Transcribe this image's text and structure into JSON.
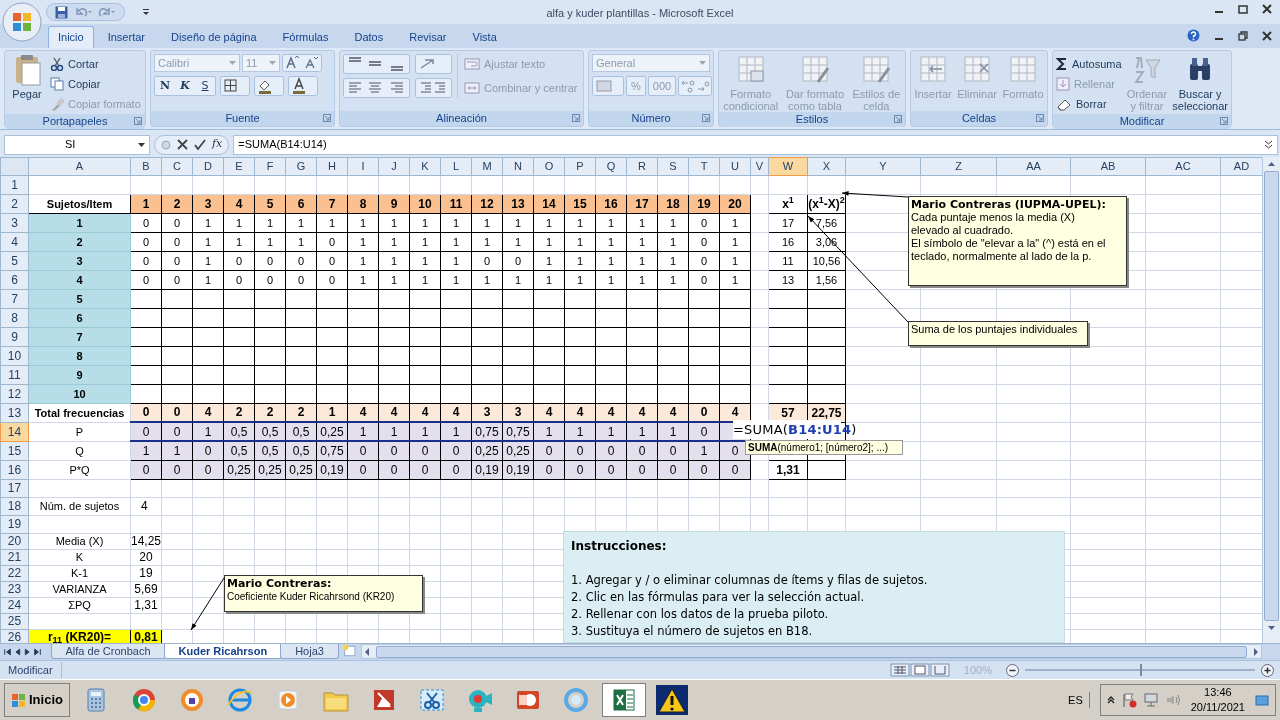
{
  "window": {
    "title": "alfa y kuder plantillas - Microsoft Excel"
  },
  "ribbon": {
    "tabs": [
      {
        "label": "Inicio",
        "selected": true
      },
      {
        "label": "Insertar",
        "selected": false
      },
      {
        "label": "Diseño de página",
        "selected": false
      },
      {
        "label": "Fórmulas",
        "selected": false
      },
      {
        "label": "Datos",
        "selected": false
      },
      {
        "label": "Revisar",
        "selected": false
      },
      {
        "label": "Vista",
        "selected": false
      }
    ],
    "groups": [
      {
        "label": "Portapapeles",
        "items": [
          {
            "label": "Pegar",
            "disabled": false
          },
          {
            "label": "Cortar",
            "disabled": false
          },
          {
            "label": "Copiar",
            "disabled": false
          },
          {
            "label": "Copiar formato",
            "disabled": true
          }
        ]
      },
      {
        "label": "Fuente",
        "items": [
          {
            "label": "Calibri",
            "disabled": true
          },
          {
            "label": "11",
            "disabled": true
          },
          {
            "label": "N",
            "disabled": false
          },
          {
            "label": "K",
            "disabled": false
          },
          {
            "label": "S",
            "disabled": false
          }
        ]
      },
      {
        "label": "Alineación",
        "items": [
          {
            "label": "Ajustar texto",
            "disabled": true
          },
          {
            "label": "Combinar y centrar",
            "disabled": true
          }
        ]
      },
      {
        "label": "Número",
        "items": [
          {
            "label": "General",
            "disabled": true
          },
          {
            "label": "%",
            "disabled": true
          },
          {
            "label": "000",
            "disabled": true
          }
        ]
      },
      {
        "label": "Estilos",
        "items": [
          {
            "label": "Formato condicional",
            "disabled": true
          },
          {
            "label": "Dar formato como tabla",
            "disabled": true
          },
          {
            "label": "Estilos de celda",
            "disabled": true
          }
        ]
      },
      {
        "label": "Celdas",
        "items": [
          {
            "label": "Insertar",
            "disabled": true
          },
          {
            "label": "Eliminar",
            "disabled": true
          },
          {
            "label": "Formato",
            "disabled": true
          }
        ]
      },
      {
        "label": "Modificar",
        "items": [
          {
            "label": "Autosuma",
            "disabled": false
          },
          {
            "label": "Rellenar",
            "disabled": true
          },
          {
            "label": "Borrar",
            "disabled": false
          },
          {
            "label": "Ordenar y filtrar",
            "disabled": true
          },
          {
            "label": "Buscar y seleccionar",
            "disabled": false
          }
        ]
      }
    ]
  },
  "formula_bar": {
    "name_box": "SI",
    "function_button": "fx",
    "formula": "=SUMA(B14:U14)"
  },
  "sheet": {
    "columns": [
      {
        "label": "A",
        "selected": false
      },
      {
        "label": "B",
        "selected": false
      },
      {
        "label": "C",
        "selected": false
      },
      {
        "label": "D",
        "selected": false
      },
      {
        "label": "E",
        "selected": false
      },
      {
        "label": "F",
        "selected": false
      },
      {
        "label": "G",
        "selected": false
      },
      {
        "label": "H",
        "selected": false
      },
      {
        "label": "I",
        "selected": false
      },
      {
        "label": "J",
        "selected": false
      },
      {
        "label": "K",
        "selected": false
      },
      {
        "label": "L",
        "selected": false
      },
      {
        "label": "M",
        "selected": false
      },
      {
        "label": "N",
        "selected": false
      },
      {
        "label": "O",
        "selected": false
      },
      {
        "label": "P",
        "selected": false
      },
      {
        "label": "Q",
        "selected": false
      },
      {
        "label": "R",
        "selected": false
      },
      {
        "label": "S",
        "selected": false
      },
      {
        "label": "T",
        "selected": false
      },
      {
        "label": "U",
        "selected": false
      },
      {
        "label": "V",
        "selected": false
      },
      {
        "label": "W",
        "selected": true
      },
      {
        "label": "X",
        "selected": false
      },
      {
        "label": "Y",
        "selected": false
      },
      {
        "label": "Z",
        "selected": false
      },
      {
        "label": "AA",
        "selected": false
      },
      {
        "label": "AB",
        "selected": false
      },
      {
        "label": "AC",
        "selected": false
      },
      {
        "label": "AD",
        "selected": false
      }
    ],
    "rows": [
      {
        "header": "1",
        "selected": false,
        "kind": "blank"
      },
      {
        "header": "2",
        "selected": false,
        "kind": "item_header",
        "label": "Sujetos/Item",
        "items": [
          "1",
          "2",
          "3",
          "4",
          "5",
          "6",
          "7",
          "8",
          "9",
          "10",
          "11",
          "12",
          "13",
          "14",
          "15",
          "16",
          "17",
          "18",
          "19",
          "20"
        ],
        "sum": "x$^{1}$",
        "square": "(x$^{1}$-X)$^{2}$"
      },
      {
        "header": "3",
        "selected": false,
        "kind": "subject",
        "label": "1",
        "items": [
          "0",
          "0",
          "1",
          "1",
          "1",
          "1",
          "1",
          "1",
          "1",
          "1",
          "1",
          "1",
          "1",
          "1",
          "1",
          "1",
          "1",
          "1",
          "0",
          "1"
        ],
        "sum": "17",
        "square": "7,56"
      },
      {
        "header": "4",
        "selected": false,
        "kind": "subject",
        "label": "2",
        "items": [
          "0",
          "0",
          "1",
          "1",
          "1",
          "1",
          "0",
          "1",
          "1",
          "1",
          "1",
          "1",
          "1",
          "1",
          "1",
          "1",
          "1",
          "1",
          "0",
          "1"
        ],
        "sum": "16",
        "square": "3,06"
      },
      {
        "header": "5",
        "selected": false,
        "kind": "subject",
        "label": "3",
        "items": [
          "0",
          "0",
          "1",
          "0",
          "0",
          "0",
          "0",
          "1",
          "1",
          "1",
          "1",
          "0",
          "0",
          "1",
          "1",
          "1",
          "1",
          "1",
          "0",
          "1"
        ],
        "sum": "11",
        "square": "10,56"
      },
      {
        "header": "6",
        "selected": false,
        "kind": "subject",
        "label": "4",
        "items": [
          "0",
          "0",
          "1",
          "0",
          "0",
          "0",
          "0",
          "1",
          "1",
          "1",
          "1",
          "1",
          "1",
          "1",
          "1",
          "1",
          "1",
          "1",
          "0",
          "1"
        ],
        "sum": "13",
        "square": "1,56"
      },
      {
        "header": "7",
        "selected": false,
        "kind": "subject",
        "label": "5"
      },
      {
        "header": "8",
        "selected": false,
        "kind": "subject",
        "label": "6"
      },
      {
        "header": "9",
        "selected": false,
        "kind": "subject",
        "label": "7"
      },
      {
        "header": "10",
        "selected": false,
        "kind": "subject",
        "label": "8"
      },
      {
        "header": "11",
        "selected": false,
        "kind": "subject",
        "label": "9"
      },
      {
        "header": "12",
        "selected": false,
        "kind": "subject",
        "label": "10"
      },
      {
        "header": "13",
        "selected": false,
        "kind": "total",
        "label": "Total frecuencias",
        "items": [
          "0",
          "0",
          "4",
          "2",
          "2",
          "2",
          "1",
          "4",
          "4",
          "4",
          "4",
          "3",
          "3",
          "4",
          "4",
          "4",
          "4",
          "4",
          "0",
          "4"
        ],
        "sum": "57",
        "square": "22,75"
      },
      {
        "header": "14",
        "selected": true,
        "kind": "prob",
        "label": "P",
        "items": [
          "0",
          "0",
          "1",
          "0,5",
          "0,5",
          "0,5",
          "0,25",
          "1",
          "1",
          "1",
          "1",
          "0,75",
          "0,75",
          "1",
          "1",
          "1",
          "1",
          "1",
          "0"
        ]
      },
      {
        "header": "15",
        "selected": false,
        "kind": "prob",
        "label": "Q",
        "items": [
          "1",
          "1",
          "0",
          "0,5",
          "0,5",
          "0,5",
          "0,75",
          "0",
          "0",
          "0",
          "0",
          "0,25",
          "0,25",
          "0",
          "0",
          "0",
          "0",
          "0",
          "1",
          "0"
        ]
      },
      {
        "header": "16",
        "selected": false,
        "kind": "prob",
        "label": "P*Q",
        "items": [
          "0",
          "0",
          "0",
          "0,25",
          "0,25",
          "0,25",
          "0,19",
          "0",
          "0",
          "0",
          "0",
          "0,19",
          "0,19",
          "0",
          "0",
          "0",
          "0",
          "0",
          "0",
          "0"
        ],
        "sum": "1,31"
      },
      {
        "header": "17",
        "selected": false,
        "kind": "blank"
      },
      {
        "header": "18",
        "selected": false,
        "kind": "stat_left",
        "label": "Núm. de sujetos",
        "value": "4"
      },
      {
        "header": "19",
        "selected": false,
        "kind": "blank"
      },
      {
        "header": "20",
        "selected": false,
        "kind": "stat",
        "label": "Media (X)",
        "value": "14,25"
      },
      {
        "header": "21",
        "selected": false,
        "kind": "stat",
        "label": "K",
        "value": "20"
      },
      {
        "header": "22",
        "selected": false,
        "kind": "stat",
        "label": "K-1",
        "value": "19"
      },
      {
        "header": "23",
        "selected": false,
        "kind": "stat",
        "label": "VARIANZA",
        "value": "5,69"
      },
      {
        "header": "24",
        "selected": false,
        "kind": "stat",
        "label": "ΣPQ",
        "value": "1,31"
      },
      {
        "header": "25",
        "selected": false,
        "kind": "blank"
      },
      {
        "header": "26",
        "selected": false,
        "kind": "result",
        "label": "r$_{11}$ (KR20)=",
        "value": "0,81"
      }
    ]
  },
  "cell_editor": {
    "prefix": "=SUMA(",
    "reference": "B14:U14",
    "suffix": ")",
    "tooltip": "**SUMA**(número1; [número2]; ...)"
  },
  "comments": [
    {
      "author": "Mario Contreras (IUPMA-UPEL):",
      "lines": [
        "Cada puntaje menos  la media (X)",
        "elevado al cuadrado.",
        "El símbolo de \"elevar a la\" (^) está en el",
        "teclado, normalmente al lado de la p."
      ]
    },
    {
      "lines": [
        "Suma de los puntajes individuales"
      ]
    },
    {
      "author": "Mario Contreras:",
      "lines": [
        "Coeficiente Kuder Ricahrsond (KR20)"
      ]
    }
  ],
  "instructions": {
    "title": "Instrucciones:",
    "lines": [
      "1. Agregar y / o eliminar columnas de ítems  y filas de sujetos.",
      "2. Clic  en las fórmulas para ver la selección actual.",
      "2. Rellenar con los datos  de la prueba piloto.",
      "3. Sustituya el número de sujetos en B18."
    ]
  },
  "sheet_tabs": [
    {
      "label": "Alfa de Cronbach",
      "selected": false
    },
    {
      "label": "Kuder Ricahrson",
      "selected": true
    },
    {
      "label": "Hoja3",
      "selected": false
    }
  ],
  "status_bar": {
    "mode": "Modificar",
    "zoom": "100%",
    "zoom_slider": {
      "level": 0.5
    }
  },
  "taskbar": {
    "start": "Inicio",
    "language": "ES",
    "time": "13:46",
    "date": "20/11/2021"
  }
}
